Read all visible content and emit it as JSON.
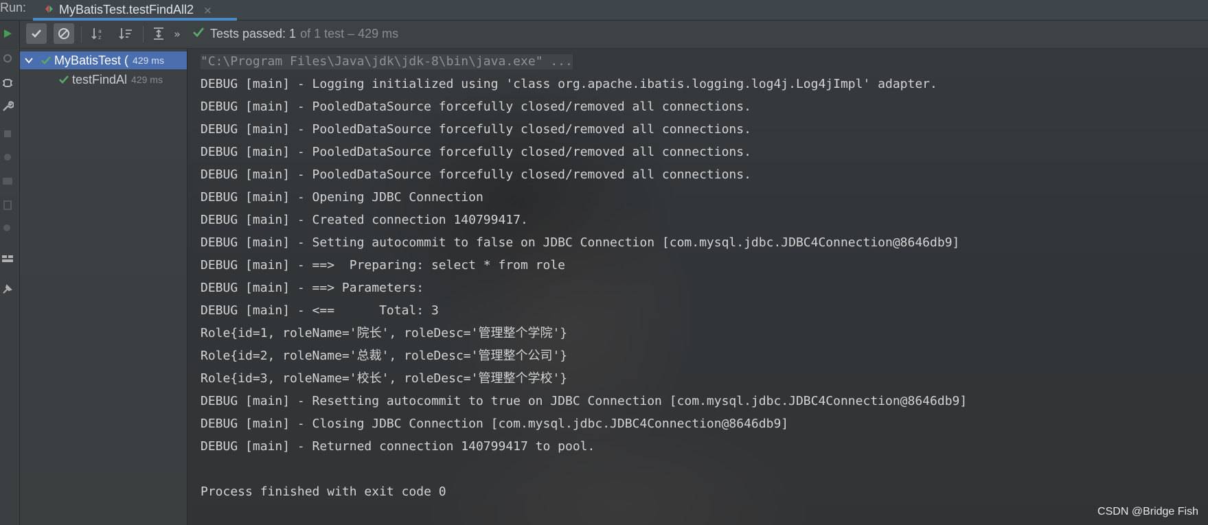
{
  "window": {
    "run_label": "Run:",
    "tab_title": "MyBatisTest.testFindAll2",
    "tab_close": "×"
  },
  "toolbar": {
    "status_passed": "Tests passed: 1",
    "status_rest": "of 1 test – 429 ms",
    "more": "»"
  },
  "tree": {
    "items": [
      {
        "label": "MyBatisTest (",
        "time": "429 ms",
        "selected": true
      },
      {
        "label": "testFindAl",
        "time": "429 ms",
        "selected": false
      }
    ]
  },
  "console": {
    "lines": [
      "\"C:\\Program Files\\Java\\jdk\\jdk-8\\bin\\java.exe\" ...",
      "DEBUG [main] - Logging initialized using 'class org.apache.ibatis.logging.log4j.Log4jImpl' adapter.",
      "DEBUG [main] - PooledDataSource forcefully closed/removed all connections.",
      "DEBUG [main] - PooledDataSource forcefully closed/removed all connections.",
      "DEBUG [main] - PooledDataSource forcefully closed/removed all connections.",
      "DEBUG [main] - PooledDataSource forcefully closed/removed all connections.",
      "DEBUG [main] - Opening JDBC Connection",
      "DEBUG [main] - Created connection 140799417.",
      "DEBUG [main] - Setting autocommit to false on JDBC Connection [com.mysql.jdbc.JDBC4Connection@8646db9]",
      "DEBUG [main] - ==>  Preparing: select * from role",
      "DEBUG [main] - ==> Parameters:",
      "DEBUG [main] - <==      Total: 3",
      "Role{id=1, roleName='院长', roleDesc='管理整个学院'}",
      "Role{id=2, roleName='总裁', roleDesc='管理整个公司'}",
      "Role{id=3, roleName='校长', roleDesc='管理整个学校'}",
      "DEBUG [main] - Resetting autocommit to true on JDBC Connection [com.mysql.jdbc.JDBC4Connection@8646db9]",
      "DEBUG [main] - Closing JDBC Connection [com.mysql.jdbc.JDBC4Connection@8646db9]",
      "DEBUG [main] - Returned connection 140799417 to pool.",
      "",
      "Process finished with exit code 0"
    ]
  },
  "watermark": "CSDN @Bridge Fish",
  "colors": {
    "accent": "#4a88c7",
    "selection": "#4b6eaf",
    "pass_green": "#59a869",
    "run_green": "#499c54"
  },
  "icons": [
    "run-icon",
    "rerun-icon",
    "debug-icon",
    "wrench-icon",
    "stop-icon",
    "layout-icon",
    "pin-icon",
    "show-passed-icon",
    "show-ignored-icon",
    "sort-alpha-icon",
    "sort-duration-icon",
    "expand-all-icon",
    "check-icon",
    "chevron-down-icon",
    "test-run-icon"
  ]
}
